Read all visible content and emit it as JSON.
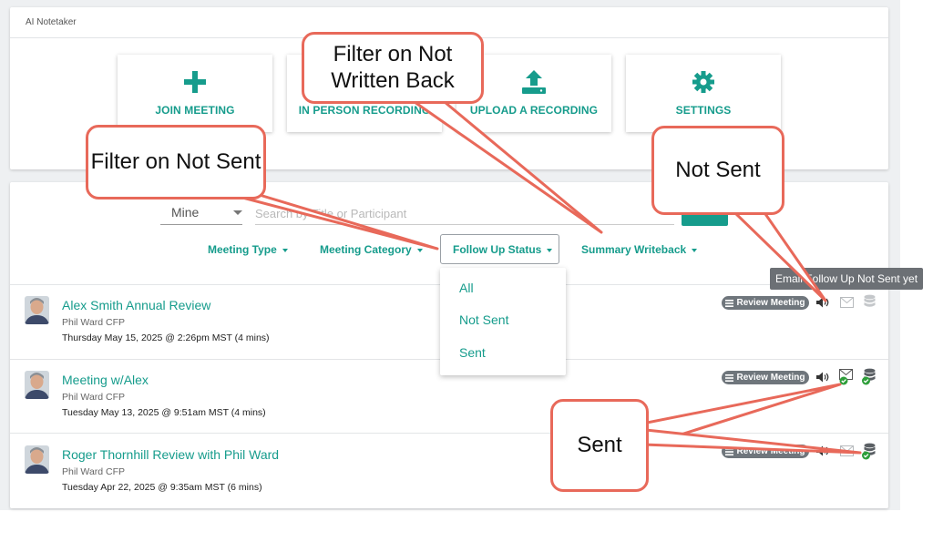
{
  "app": {
    "title": "AI Notetaker"
  },
  "tiles": [
    {
      "label": "JOIN MEETING",
      "icon": "plus-icon"
    },
    {
      "label": "IN PERSON RECORDING",
      "icon": "microphone-icon"
    },
    {
      "label": "UPLOAD A RECORDING",
      "icon": "upload-icon"
    },
    {
      "label": "SETTINGS",
      "icon": "gear-icon"
    }
  ],
  "search": {
    "owner_value": "Mine",
    "placeholder": "Search by Title or Participant"
  },
  "filters": {
    "meeting_type": "Meeting Type",
    "meeting_category": "Meeting Category",
    "follow_up_status": "Follow Up Status",
    "summary_writeback": "Summary Writeback"
  },
  "follow_up_dropdown": {
    "options": [
      "All",
      "Not Sent",
      "Sent"
    ]
  },
  "meetings": [
    {
      "title": "Alex Smith Annual Review",
      "owner": "Phil Ward CFP",
      "date": "Thursday May 15, 2025 @ 2:26pm MST (4 mins)",
      "badge": "Review Meeting",
      "email_status": "not-sent",
      "writeback_status": "not-written"
    },
    {
      "title": "Meeting w/Alex",
      "owner": "Phil Ward CFP",
      "date": "Tuesday May 13, 2025 @ 9:51am MST (4 mins)",
      "badge": "Review Meeting",
      "email_status": "sent",
      "writeback_status": "written"
    },
    {
      "title": "Roger Thornhill Review with Phil Ward",
      "owner": "Phil Ward CFP",
      "date": "Tuesday Apr 22, 2025 @ 9:35am MST (6 mins)",
      "badge": "Review Meeting",
      "email_status": "not-sent",
      "writeback_status": "written"
    }
  ],
  "tooltip": {
    "text": "Email Follow Up Not Sent yet"
  },
  "callouts": {
    "filter_not_written_back": "Filter on Not Written Back",
    "filter_not_sent": "Filter on Not Sent",
    "not_sent": "Not Sent",
    "sent": "Sent"
  },
  "colors": {
    "accent": "#169c8c",
    "callout_border": "#e8695a",
    "badge_bg": "#6f767c",
    "success": "#2e9e3a"
  }
}
